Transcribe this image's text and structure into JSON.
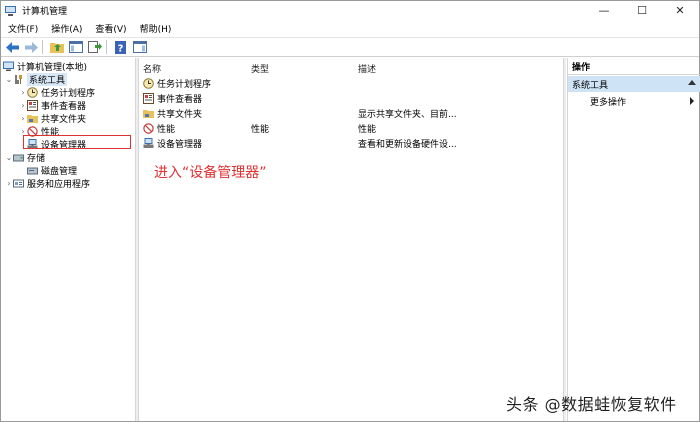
{
  "window": {
    "title": "计算机管理",
    "controls": {
      "minimize": "—",
      "maximize": "☐",
      "close": "✕"
    }
  },
  "menubar": {
    "items": [
      "文件(F)",
      "操作(A)",
      "查看(V)",
      "帮助(H)"
    ]
  },
  "toolbar": {
    "buttons": [
      "back-icon",
      "forward-icon",
      "up-folder-icon",
      "show-hide-tree-icon",
      "export-list-icon",
      "help-icon",
      "show-action-pane-icon"
    ]
  },
  "tree": {
    "root": "计算机管理(本地)",
    "system_tools": "系统工具",
    "task_scheduler": "任务计划程序",
    "event_viewer": "事件查看器",
    "shared_folders": "共享文件夹",
    "performance": "性能",
    "device_manager": "设备管理器",
    "storage": "存储",
    "disk_management": "磁盘管理",
    "services_apps": "服务和应用程序"
  },
  "list": {
    "columns": {
      "name": "名称",
      "type": "类型",
      "description": "描述"
    },
    "rows": [
      {
        "name": "任务计划程序",
        "type": "",
        "description": ""
      },
      {
        "name": "事件查看器",
        "type": "",
        "description": ""
      },
      {
        "name": "共享文件夹",
        "type": "",
        "description": "显示共享文件夹、目前..."
      },
      {
        "name": "性能",
        "type": "性能",
        "description": "性能"
      },
      {
        "name": "设备管理器",
        "type": "",
        "description": "查看和更新设备硬件设..."
      }
    ]
  },
  "annotation": "进入“设备管理器”",
  "actions": {
    "title": "操作",
    "section": "系统工具",
    "more": "更多操作"
  },
  "watermark": "头条 @数据蛙恢复软件",
  "colors": {
    "highlight_red": "#e03131",
    "section_blue": "#cfe3f6",
    "selection_blue": "#d9e8f7"
  }
}
